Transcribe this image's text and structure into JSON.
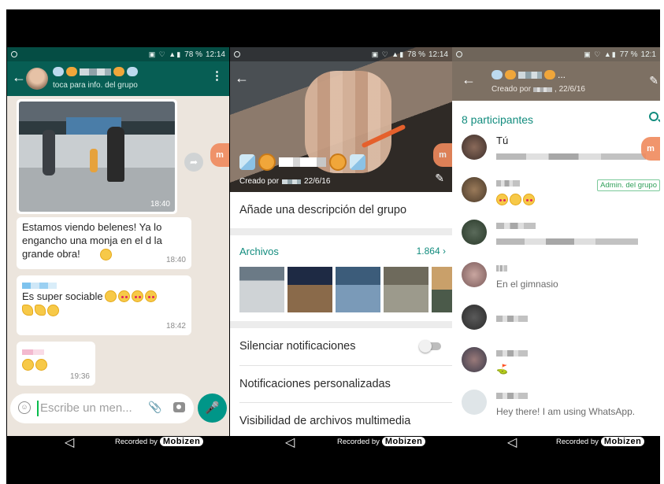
{
  "status_bar": {
    "p1": {
      "battery": "78 %",
      "time": "12:14"
    },
    "p2": {
      "battery": "78 %",
      "time": "12:14"
    },
    "p3": {
      "battery": "77 %",
      "time": "12:1"
    }
  },
  "chat": {
    "subtitle": "toca para info. del grupo",
    "photo_time": "18:40",
    "messages": [
      {
        "text": "Estamos viendo belenes! Ya lo engancho una monja en el d la grande obra!",
        "time": "18:40"
      },
      {
        "text": "Es super sociable",
        "time": "18:42"
      },
      {
        "text": "",
        "time": "19:36"
      }
    ],
    "composer_placeholder": "Escribe un men..."
  },
  "group_info": {
    "created_by_label": "Creado por",
    "created_date": "22/6/16",
    "add_description": "Añade una descripción del grupo",
    "files_label": "Archivos",
    "files_count": "1.864",
    "files_chevron": "›",
    "mute_notifications": "Silenciar notificaciones",
    "custom_notifications": "Notificaciones personalizadas",
    "media_visibility": "Visibilidad de archivos multimedia"
  },
  "participants_screen": {
    "created_by": "Creado por",
    "created_date": ", 22/6/16",
    "count_label": "8 participantes",
    "participants": [
      {
        "name": "Tú",
        "status": ""
      },
      {
        "name": "",
        "status": "",
        "badge": "Admin. del grupo"
      },
      {
        "name": "",
        "status": ""
      },
      {
        "name": "",
        "status": "En el gimnasio"
      },
      {
        "name": "",
        "status": ""
      },
      {
        "name": "",
        "status": ""
      },
      {
        "name": "",
        "status": "Hey there! I am using WhatsApp."
      }
    ]
  },
  "recording": {
    "label": "Recorded by",
    "brand": "Mobizen"
  },
  "colors": {
    "whatsapp_teal": "#075e54",
    "accent_green": "#128c7e",
    "mic_green": "#009688",
    "chat_bg": "#ece5dd"
  }
}
